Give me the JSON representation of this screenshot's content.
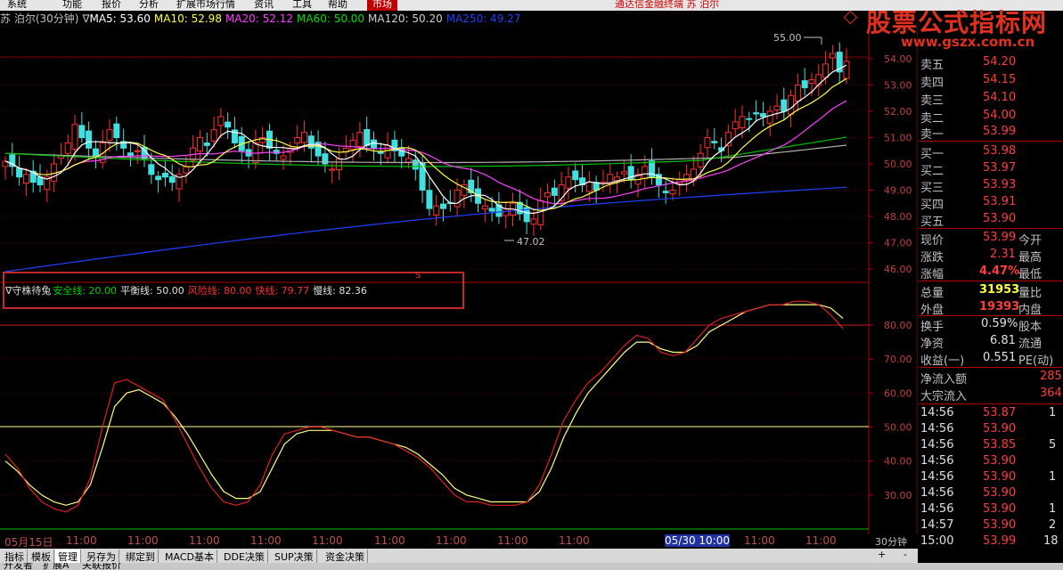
{
  "menu": {
    "items": [
      "系统",
      "功能",
      "报价",
      "分析",
      "扩展市场行情",
      "资讯",
      "工具",
      "帮助"
    ],
    "market": "市场",
    "center": "通达信金融终端  苏 泊尔"
  },
  "watermark": {
    "title": "股票公式指标网",
    "url": "www.gszx.com.cn"
  },
  "price_header": {
    "stock": "苏 泊尔(30分钟)",
    "arrow": "∇",
    "ma5": "MA5: 53.60",
    "ma10": "MA10: 52.98",
    "ma20": "MA20: 52.12",
    "ma60": "MA60: 50.00",
    "ma120": "MA120: 50.20",
    "ma250": "MA250: 49.27"
  },
  "price_axis": [
    "54.00",
    "53.00",
    "52.00",
    "51.00",
    "50.00",
    "49.00",
    "48.00",
    "47.00",
    "46.00"
  ],
  "price_annotations": {
    "high": "55.00",
    "low": "47.02"
  },
  "indicator": {
    "name": "∇守株待兔",
    "safe": "安全线: 20.00",
    "balance": "平衡线: 50.00",
    "risk": "风险线: 80.00",
    "fast": "快线: 79.77",
    "slow": "慢线: 82.36",
    "signal": "S"
  },
  "indicator_axis": [
    "80.00",
    "70.00",
    "60.00",
    "50.00",
    "40.00",
    "30.00"
  ],
  "time_axis": [
    "05月15日",
    "11:00",
    "11:00",
    "11:00",
    "11:00",
    "11:00",
    "11:00",
    "11:00",
    "11:00",
    "11:00",
    "05/30 10:00",
    "11:00",
    "11:00",
    "11:00"
  ],
  "period_tab": "30分钟",
  "bottom_tabs": [
    "指标",
    "模板",
    "管理",
    "另存为",
    "绑定到",
    "MACD基本",
    "DDE决策",
    "SUP决策",
    "资金决策"
  ],
  "bottom_row2": [
    "开发者",
    "扩展A",
    "关联报价"
  ],
  "order_book": {
    "asks": [
      {
        "label": "卖五",
        "price": "54.20"
      },
      {
        "label": "卖四",
        "price": "54.15"
      },
      {
        "label": "卖三",
        "price": "54.10"
      },
      {
        "label": "卖二",
        "price": "54.00"
      },
      {
        "label": "卖一",
        "price": "53.99"
      }
    ],
    "bids": [
      {
        "label": "买一",
        "price": "53.98"
      },
      {
        "label": "买二",
        "price": "53.97"
      },
      {
        "label": "买三",
        "price": "53.93"
      },
      {
        "label": "买四",
        "price": "53.91"
      },
      {
        "label": "买五",
        "price": "53.90"
      }
    ]
  },
  "quote": [
    {
      "l1": "现价",
      "v": "53.99",
      "l2": "今开",
      "color": "red"
    },
    {
      "l1": "涨跌",
      "v": "2.31",
      "l2": "最高",
      "color": "red"
    },
    {
      "l1": "涨幅",
      "v": "4.47%",
      "l2": "最低",
      "color": "red"
    },
    {
      "l1": "总量",
      "v": "31953",
      "l2": "量比",
      "color": "yel"
    },
    {
      "l1": "外盘",
      "v": "19393",
      "l2": "内盘",
      "color": "red"
    },
    {
      "l1": "换手",
      "v": "0.59%",
      "l2": "股本",
      "color": "wht"
    },
    {
      "l1": "净资",
      "v": "6.81",
      "l2": "流通",
      "color": "wht"
    },
    {
      "l1": "收益(一)",
      "v": "0.551",
      "l2": "PE(动)",
      "color": "wht"
    }
  ],
  "flow": [
    {
      "label": "净流入额",
      "value": "285"
    },
    {
      "label": "大宗流入",
      "value": "364"
    }
  ],
  "ticks": [
    {
      "time": "14:56",
      "price": "53.87",
      "vol": "1"
    },
    {
      "time": "14:56",
      "price": "53.90",
      "vol": ""
    },
    {
      "time": "14:56",
      "price": "53.85",
      "vol": "5"
    },
    {
      "time": "14:56",
      "price": "53.90",
      "vol": ""
    },
    {
      "time": "14:56",
      "price": "53.90",
      "vol": "1"
    },
    {
      "time": "14:56",
      "price": "53.90",
      "vol": ""
    },
    {
      "time": "14:56",
      "price": "53.90",
      "vol": "1"
    },
    {
      "time": "14:57",
      "price": "53.90",
      "vol": "2"
    },
    {
      "time": "15:00",
      "price": "53.99",
      "vol": "18"
    }
  ],
  "colors": {
    "up": "#ff3030",
    "down": "#40e0e0",
    "ma5": "#ffffff",
    "ma10": "#ffff40",
    "ma20": "#ff40ff",
    "ma60": "#00e000",
    "ma120": "#b0b0b0",
    "ma250": "#2040ff",
    "fast": "#e02020",
    "slow": "#ffff80"
  }
}
